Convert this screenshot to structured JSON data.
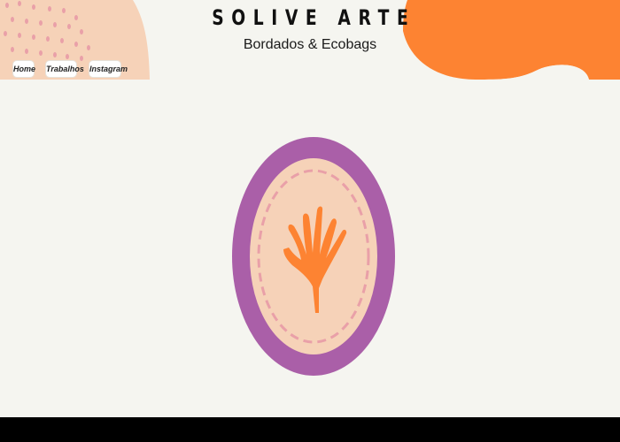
{
  "header": {
    "title": "SOLIVE ARTE",
    "subtitle": "Bordados & Ecobags"
  },
  "nav": {
    "items": [
      {
        "label": "Home"
      },
      {
        "label": "Trabalhos"
      },
      {
        "label": "Instagram"
      }
    ]
  },
  "logo": {
    "icon": "embroidery-hoop-hand-icon"
  },
  "colors": {
    "background": "#f5f5f0",
    "peach": "#f6d2b8",
    "orange": "#fd8332",
    "purple": "#aa5fa8",
    "dots": "#e9a0a8",
    "footer": "#000000"
  }
}
